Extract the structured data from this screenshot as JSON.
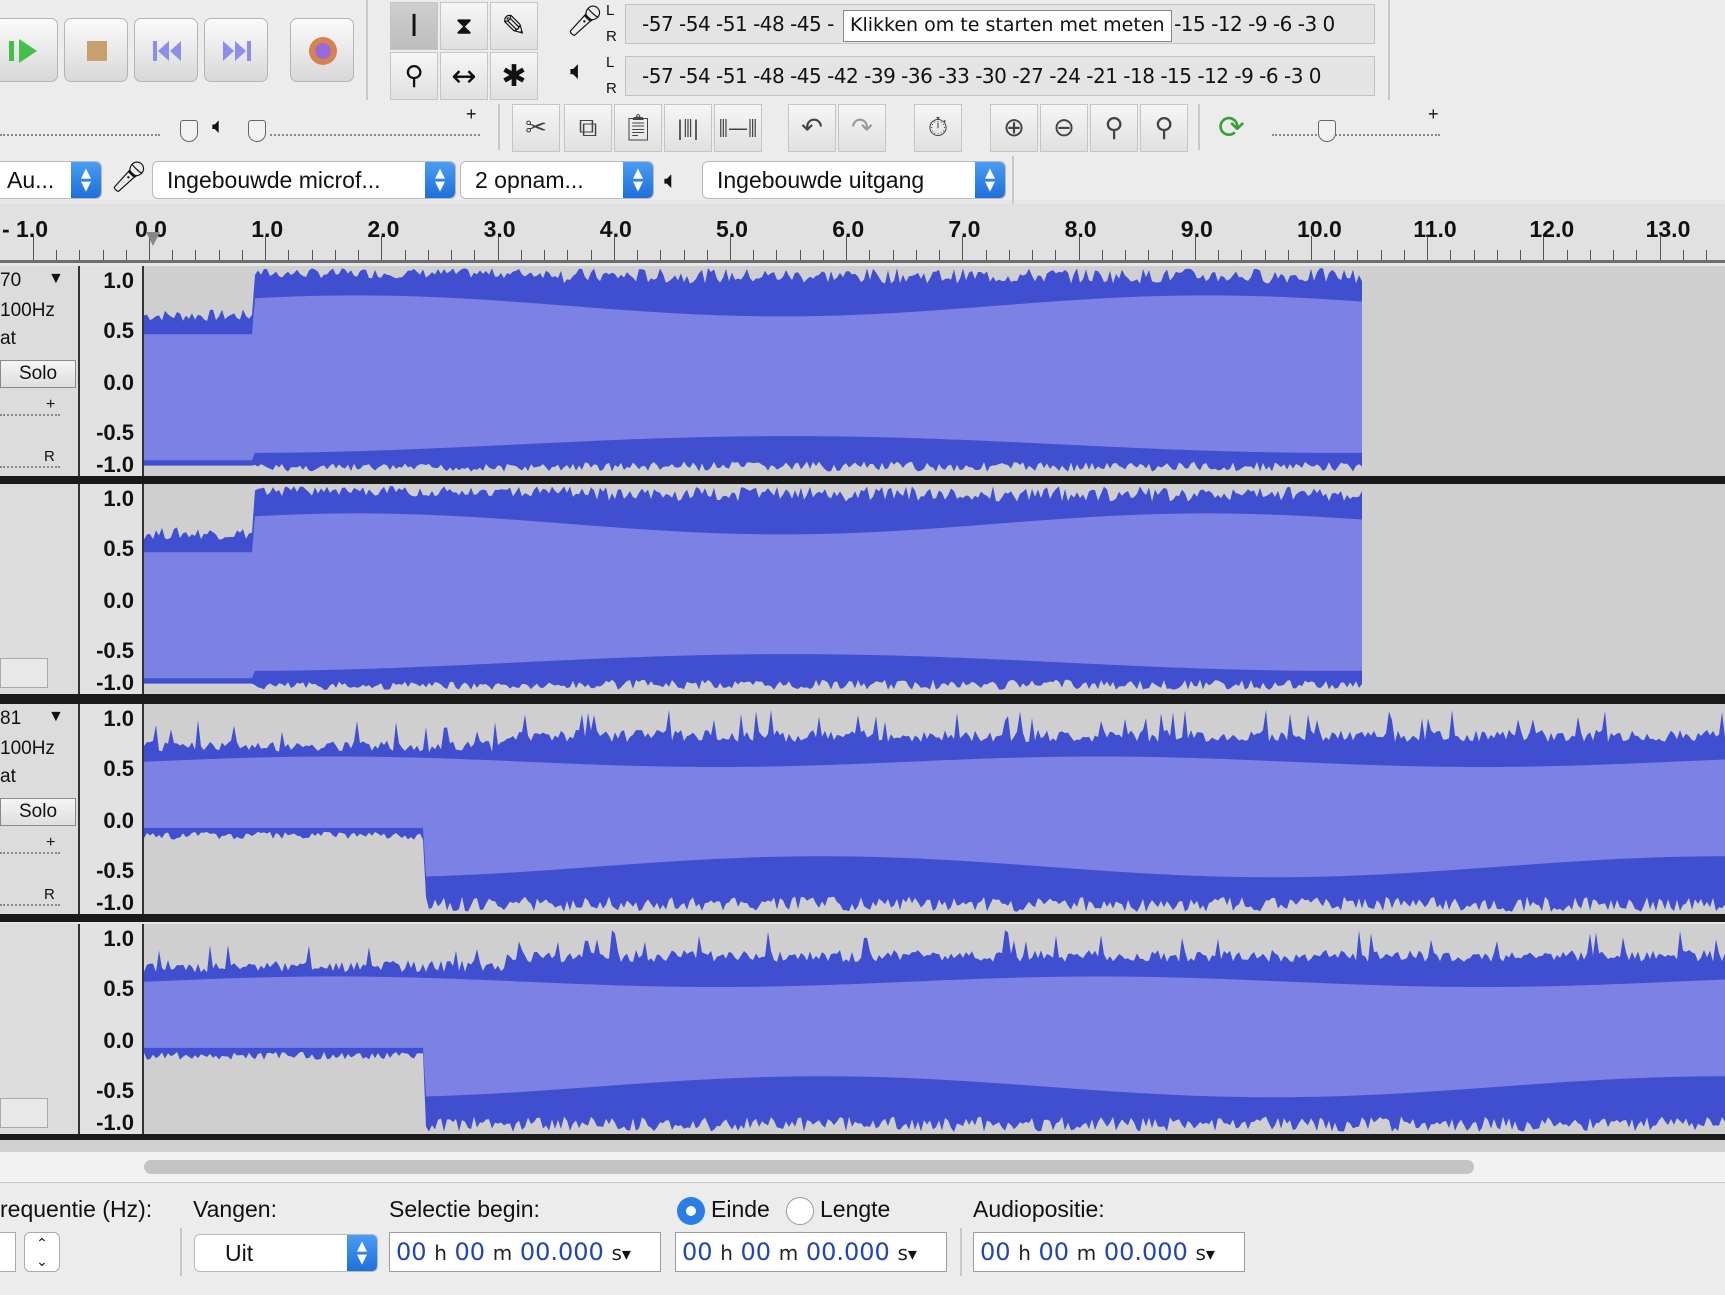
{
  "transport": {
    "buttons": [
      "play",
      "stop",
      "skip-start",
      "skip-end",
      "record"
    ]
  },
  "meters": {
    "record_scale": "-57 -54 -51 -48 -45 -",
    "record_scale_tail": "8 -15 -12  -9   -6   -3   0",
    "record_tooltip": "Klikken om te starten met meten",
    "play_scale": "-57 -54 -51 -48 -45 -42 -39 -36 -33 -30 -27 -24 -21 -18 -15 -12  -9   -6   -3   0",
    "l": "L",
    "r": "R"
  },
  "devices": {
    "host": "Au...",
    "input": "Ingebouwde microf...",
    "channels": "2 opnam...",
    "output": "Ingebouwde uitgang"
  },
  "ruler": {
    "labels": [
      "- 1.0",
      "0.0",
      "1.0",
      "2.0",
      "3.0",
      "4.0",
      "5.0",
      "6.0",
      "7.0",
      "8.0",
      "9.0",
      "10.0",
      "11.0",
      "12.0",
      "13.0"
    ]
  },
  "tracks": [
    {
      "name": "70",
      "rate": "100Hz",
      "format": "at",
      "solo": "Solo",
      "plus": "+",
      "r": "R"
    },
    {
      "name": "81",
      "rate": "100Hz",
      "format": "at",
      "solo": "Solo",
      "plus": "+",
      "r": "R"
    }
  ],
  "vscale": [
    "1.0",
    "0.5",
    "0.0",
    "-0.5",
    "-1.0"
  ],
  "status": {
    "freq_label": "requentie (Hz):",
    "snap_label": "Vangen:",
    "snap_value": "Uit",
    "sel_begin_label": "Selectie begin:",
    "end_label": "Einde",
    "length_label": "Lengte",
    "audio_pos_label": "Audiopositie:",
    "t_hh": "00",
    "t_mm": "00",
    "t_ss": "00.000",
    "u_h": "h",
    "u_m": "m",
    "u_s": "s"
  },
  "colors": {
    "wave_dark": "#3f4fd0",
    "wave_light": "#7b82e4",
    "background": "#cfcfcf",
    "accent": "#1e6fd9"
  }
}
